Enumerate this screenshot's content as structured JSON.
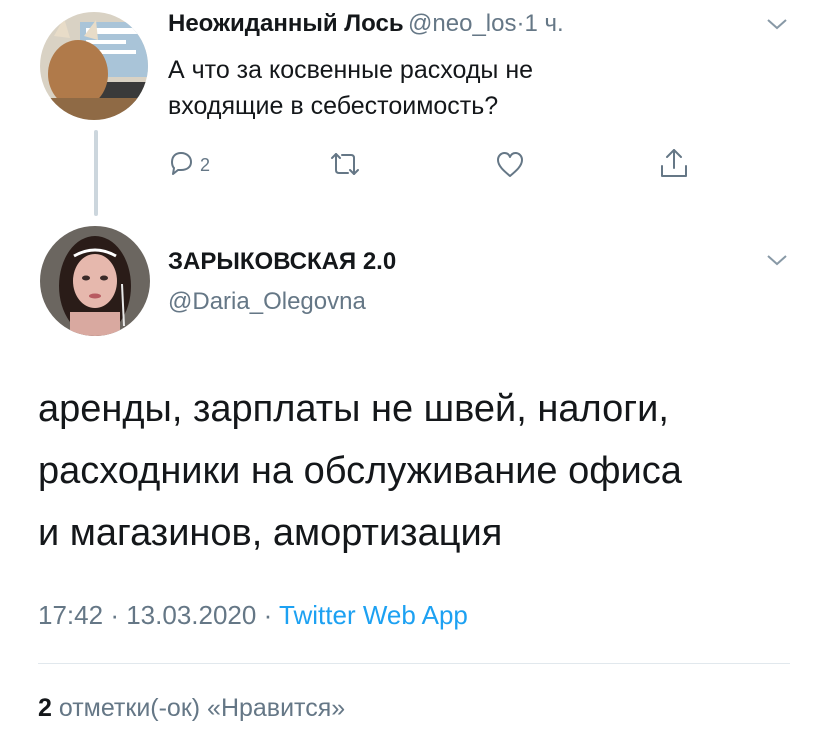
{
  "reply_tweet": {
    "author_name": "Неожиданный Лось",
    "author_handle": "@neo_los",
    "separator": "·",
    "time": "1 ч.",
    "text_line1": "А что за косвенные расходы не",
    "text_line2": "входящие в себестоимость?",
    "reply_count": "2",
    "icons": [
      "reply-icon",
      "retweet-icon",
      "like-icon",
      "share-icon",
      "chevron-down-icon"
    ]
  },
  "main_tweet": {
    "author_name": "ЗАРЫКОВСКАЯ 2.0",
    "author_handle": "@Daria_Olegovna",
    "text_line1": "аренды, зарплаты не швей, налоги,",
    "text_line2": "расходники на обслуживание офиса",
    "text_line3": "и магазинов, амортизация",
    "time": "17:42",
    "dot": "·",
    "date": "13.03.2020",
    "source": "Twitter Web App",
    "likes_count": "2",
    "likes_label": "отметки(-ок) «Нравится»"
  },
  "colors": {
    "text": "#14171a",
    "secondary": "#657786",
    "link": "#1da1f2",
    "divider": "#e1e8ed"
  }
}
